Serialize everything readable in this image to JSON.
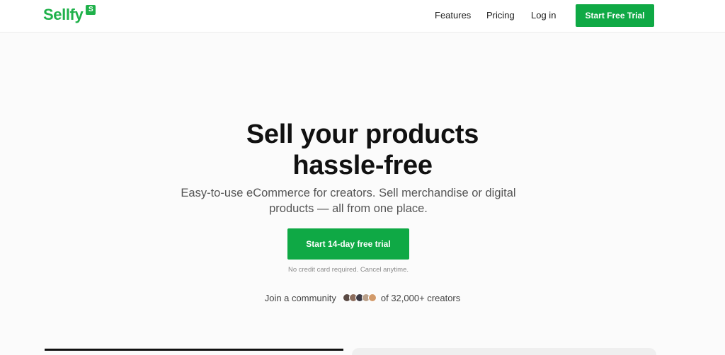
{
  "header": {
    "logo_text": "Sellfy",
    "logo_badge": "S",
    "nav": [
      {
        "label": "Features"
      },
      {
        "label": "Pricing"
      },
      {
        "label": "Log in"
      }
    ],
    "cta_label": "Start Free Trial"
  },
  "hero": {
    "title_line1": "Sell your products",
    "title_line2": "hassle-free",
    "subtitle_line1": "Easy-to-use eCommerce for creators. Sell merchandise or digital",
    "subtitle_line2": "products — all from one place.",
    "cta_label": "Start 14-day free trial",
    "fine_print": "No credit card required. Cancel anytime.",
    "community_prefix": "Join a community",
    "community_suffix": "of 32,000+ creators"
  },
  "colors": {
    "brand_green": "#1fb14a",
    "button_green": "#0fa945",
    "background": "#fbfbfb"
  },
  "avatars": [
    {
      "color": "#5a4a44"
    },
    {
      "color": "#8c6d5d"
    },
    {
      "color": "#3d3a45"
    },
    {
      "color": "#b9a08a"
    },
    {
      "color": "#d29a6a"
    }
  ]
}
